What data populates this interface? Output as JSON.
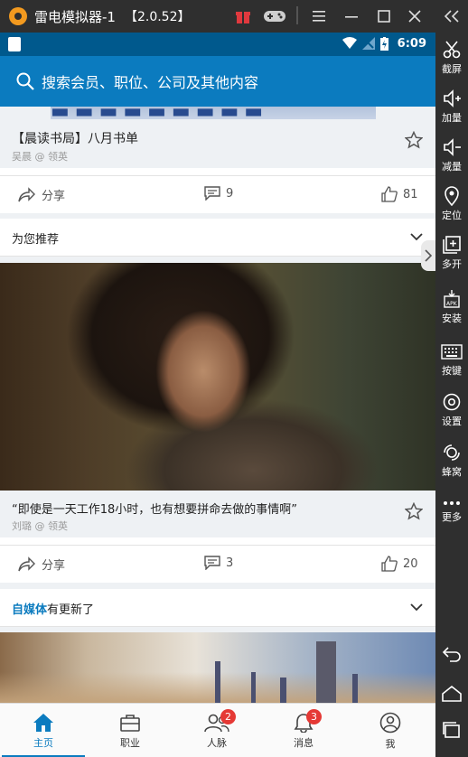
{
  "emulator": {
    "app_name": "雷电模拟器-1",
    "version": "【2.0.52】"
  },
  "sidebar": {
    "items": [
      {
        "label": "截屏",
        "icon": "scissors-icon"
      },
      {
        "label": "加量",
        "icon": "volume-up-icon"
      },
      {
        "label": "减量",
        "icon": "volume-down-icon"
      },
      {
        "label": "定位",
        "icon": "location-icon"
      },
      {
        "label": "多开",
        "icon": "multi-window-icon"
      },
      {
        "label": "安装",
        "icon": "apk-install-icon"
      },
      {
        "label": "按键",
        "icon": "keyboard-icon"
      },
      {
        "label": "设置",
        "icon": "gear-icon"
      },
      {
        "label": "蜂窝",
        "icon": "cellular-icon"
      },
      {
        "label": "更多",
        "icon": "more-dots-icon"
      }
    ]
  },
  "status_bar": {
    "time": "6:09"
  },
  "search": {
    "placeholder": "搜索会员、职位、公司及其他内容"
  },
  "feed": {
    "post1": {
      "title": "【晨读书局】八月书单",
      "author": "吴晨 @ 领英",
      "share_label": "分享",
      "comments": "9",
      "likes": "81"
    },
    "recommend": {
      "title": "为您推荐"
    },
    "post2": {
      "title": "“即使是一天工作18小时，也有想要拼命去做的事情啊”",
      "author": "刘璐 @ 领英",
      "share_label": "分享",
      "comments": "3",
      "likes": "20"
    },
    "media": {
      "accent": "自媒体",
      "rest": "有更新了"
    }
  },
  "bottom_nav": {
    "items": [
      {
        "label": "主页",
        "icon": "home-icon",
        "active": true
      },
      {
        "label": "职业",
        "icon": "briefcase-icon"
      },
      {
        "label": "人脉",
        "icon": "people-icon",
        "badge": "2"
      },
      {
        "label": "消息",
        "icon": "bell-icon",
        "badge": "3"
      },
      {
        "label": "我",
        "icon": "profile-icon"
      }
    ]
  },
  "colors": {
    "brand_blue": "#0b7bbf",
    "status_blue": "#00598d",
    "badge_red": "#e53935"
  }
}
